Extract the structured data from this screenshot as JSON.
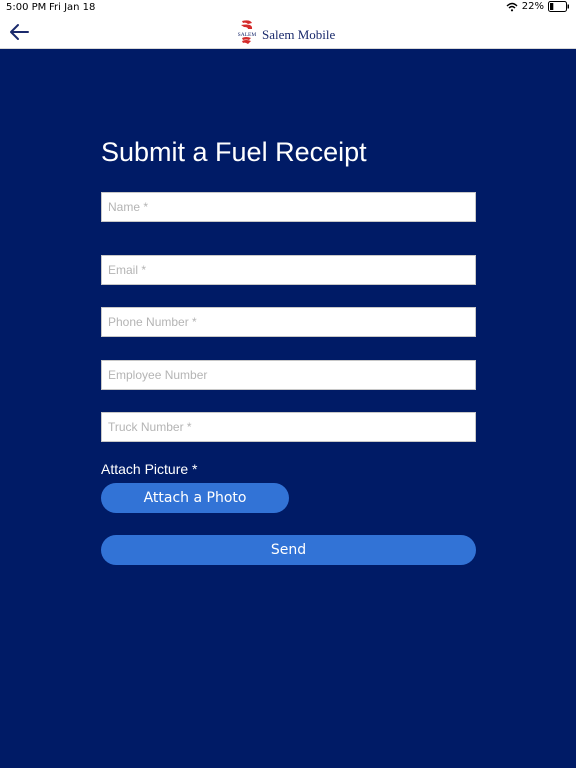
{
  "status_bar": {
    "time": "5:00 PM",
    "date": "Fri Jan 18",
    "battery_percent": "22%",
    "battery_level": 0.22,
    "wifi_icon": "wifi-icon",
    "battery_icon": "battery-icon"
  },
  "nav": {
    "back_icon": "arrow-left-icon",
    "logo_text": "SALEM",
    "app_title": "Salem Mobile",
    "accent_color": "#1a2a6c",
    "logo_red": "#d42b2b"
  },
  "form": {
    "title": "Submit a Fuel Receipt",
    "background_color": "#001b66",
    "fields": {
      "name_placeholder": "Name *",
      "email_placeholder": "Email *",
      "phone_placeholder": "Phone Number *",
      "employee_placeholder": "Employee Number",
      "truck_placeholder": "Truck Number *"
    },
    "attach_label": "Attach Picture *",
    "attach_button": "Attach a Photo",
    "send_button": "Send",
    "button_color": "#3273d6"
  }
}
